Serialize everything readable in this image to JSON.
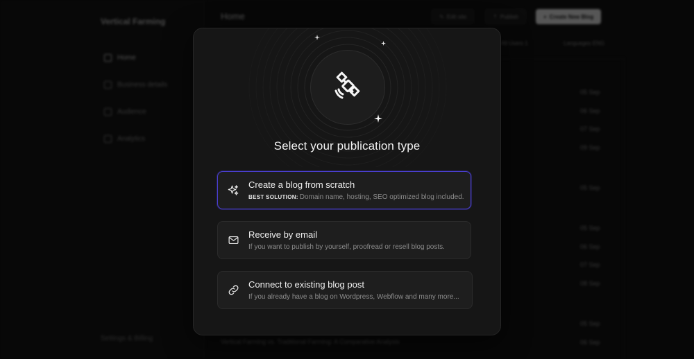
{
  "app": {
    "brand": "Vertical Farming",
    "page_title": "Home",
    "sidebar": {
      "items": [
        {
          "label": "Home",
          "icon": "home-icon"
        },
        {
          "label": "Business details",
          "icon": "briefcase-icon"
        },
        {
          "label": "Audience",
          "icon": "users-icon"
        },
        {
          "label": "Analytics",
          "icon": "chart-icon"
        }
      ],
      "settings_label": "Settings & Billing"
    },
    "toolbar": {
      "edit_label": "Edit site",
      "publish_label": "Publish",
      "create_label": "Create New Blog"
    },
    "filters": {
      "users_label": "All Users",
      "users_count": "1",
      "language_label": "Languages",
      "language_value": "ENG"
    },
    "dates": [
      "05 Sep",
      "06 Sep",
      "07 Sep",
      "09 Sep",
      "05 Sep",
      "05 Sep",
      "06 Sep",
      "07 Sep",
      "08 Sep",
      "05 Sep",
      "06 Sep"
    ],
    "last_row_title": "Vertical Farming vs. Traditional Farming: A Comparative Analysis"
  },
  "modal": {
    "title": "Select your publication type",
    "options": [
      {
        "title": "Create a blog from scratch",
        "tag": "BEST SOLUTION:",
        "description": "Domain name, hosting, SEO optimized blog included.",
        "icon": "sparkles-icon",
        "selected": true
      },
      {
        "title": "Receive by email",
        "description": "If you want to publish by yourself, proofread or resell blog posts.",
        "icon": "mail-icon",
        "selected": false
      },
      {
        "title": "Connect to existing blog post",
        "description": "If you already have a blog on Wordpress, Webflow and many more...",
        "icon": "link-icon",
        "selected": false
      }
    ]
  },
  "colors": {
    "accent": "#4a3fd1",
    "modal_bg": "#161616",
    "option_bg": "#1e1e1e"
  }
}
